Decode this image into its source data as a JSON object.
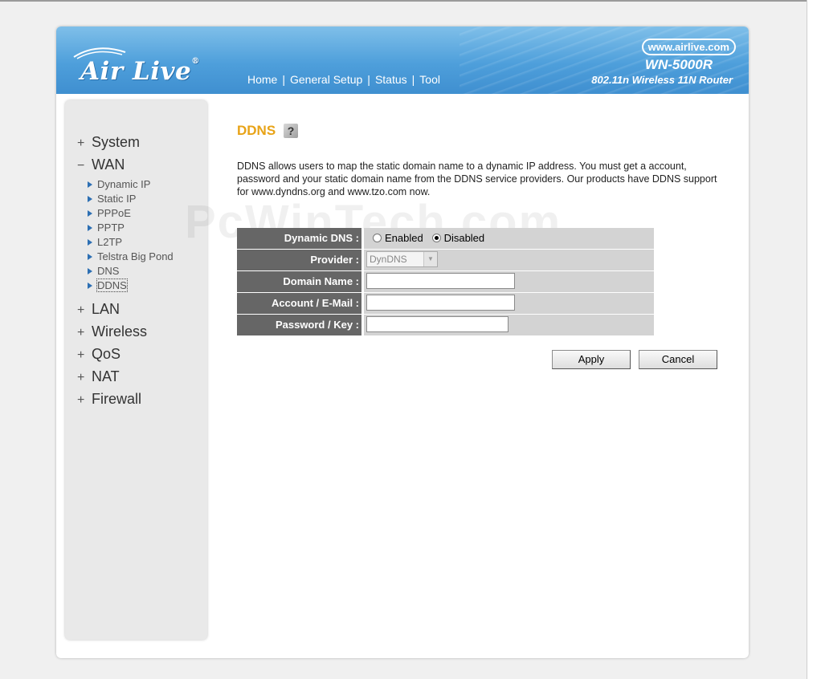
{
  "header": {
    "logo_text": "Air Live",
    "logo_reg": "®",
    "nav": [
      "Home",
      "General Setup",
      "Status",
      "Tool"
    ],
    "url": "www.airlive.com",
    "model": "WN-5000R",
    "subtitle": "802.11n Wireless 11N Router"
  },
  "sidebar": {
    "sections": [
      {
        "sign": "+",
        "label": "System"
      },
      {
        "sign": "−",
        "label": "WAN"
      },
      {
        "sign": "+",
        "label": "LAN"
      },
      {
        "sign": "+",
        "label": "Wireless"
      },
      {
        "sign": "+",
        "label": "QoS"
      },
      {
        "sign": "+",
        "label": "NAT"
      },
      {
        "sign": "+",
        "label": "Firewall"
      }
    ],
    "wan_items": [
      "Dynamic IP",
      "Static IP",
      "PPPoE",
      "PPTP",
      "L2TP",
      "Telstra Big Pond",
      "DNS",
      "DDNS"
    ],
    "active_item": "DDNS"
  },
  "page": {
    "title": "DDNS",
    "help_icon": "help-icon",
    "description": "DDNS allows users to map the static domain name to a dynamic IP address. You must get a account, password and your static domain name from the DDNS service providers. Our products have DDNS support for www.dyndns.org and www.tzo.com now.",
    "watermark": "PcWinTech.com"
  },
  "form": {
    "dynamic_dns_label": "Dynamic DNS :",
    "enabled_label": "Enabled",
    "disabled_label": "Disabled",
    "dynamic_dns_value": "Disabled",
    "provider_label": "Provider :",
    "provider_value": "DynDNS",
    "domain_label": "Domain Name :",
    "domain_value": "",
    "account_label": "Account / E-Mail :",
    "account_value": "",
    "password_label": "Password / Key :",
    "password_value": ""
  },
  "buttons": {
    "apply": "Apply",
    "cancel": "Cancel"
  }
}
